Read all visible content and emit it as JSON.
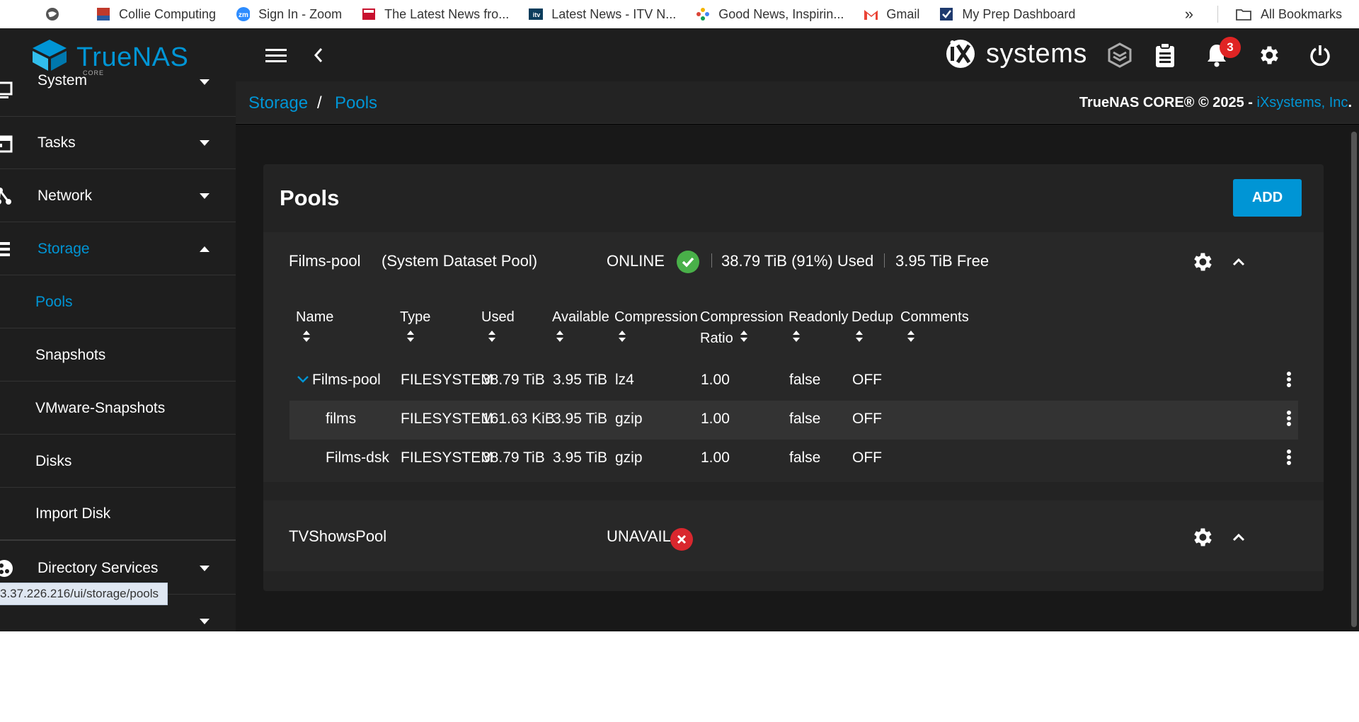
{
  "bookmarks": {
    "items": [
      {
        "label": "Collie Computing",
        "icon": "collie-favicon"
      },
      {
        "label": "Sign In - Zoom",
        "icon": "zoom-favicon"
      },
      {
        "label": "The Latest News fro...",
        "icon": "sky-news-favicon"
      },
      {
        "label": "Latest News - ITV N...",
        "icon": "itv-favicon"
      },
      {
        "label": "Good News, Inspirin...",
        "icon": "dots-favicon"
      },
      {
        "label": "Gmail",
        "icon": "gmail-favicon"
      },
      {
        "label": "My Prep Dashboard",
        "icon": "checkmark-favicon"
      }
    ],
    "more": "»",
    "all_bookmarks": "All Bookmarks"
  },
  "topbar": {
    "logo_text": "TrueNAS",
    "logo_sub": "CORE",
    "brand_text": "systems",
    "notification_count": "3"
  },
  "sidebar": {
    "items": [
      {
        "label": "System",
        "icon": "monitor-icon",
        "expanded": false
      },
      {
        "label": "Tasks",
        "icon": "calendar-icon",
        "expanded": false
      },
      {
        "label": "Network",
        "icon": "network-icon",
        "expanded": false
      },
      {
        "label": "Storage",
        "icon": "storage-icon",
        "expanded": true
      }
    ],
    "storage_sub": [
      {
        "label": "Pools",
        "active": true
      },
      {
        "label": "Snapshots",
        "active": false
      },
      {
        "label": "VMware-Snapshots",
        "active": false
      },
      {
        "label": "Disks",
        "active": false
      },
      {
        "label": "Import Disk",
        "active": false
      }
    ],
    "directory_services": "Directory Services",
    "url_tooltip": "3.37.226.216/ui/storage/pools"
  },
  "breadcrumb": {
    "parent": "Storage",
    "separator": "/",
    "current": "Pools"
  },
  "copyright": {
    "text": "TrueNAS CORE® © 2025 - ",
    "link": "iXsystems, Inc",
    "end": "."
  },
  "page": {
    "title": "Pools",
    "add_label": "ADD"
  },
  "pools": [
    {
      "name": "Films-pool",
      "note": "(System Dataset Pool)",
      "status": "ONLINE",
      "used": "38.79 TiB (91%) Used",
      "free": "3.95 TiB Free"
    },
    {
      "name": "TVShowsPool",
      "status": "UNAVAIL"
    }
  ],
  "table": {
    "columns": [
      "Name",
      "Type",
      "Used",
      "Available",
      "Compression",
      "Compression Ratio",
      "Readonly",
      "Dedup",
      "Comments"
    ],
    "col_ratio_line1": "Compression",
    "col_ratio_line2": "Ratio",
    "rows": [
      {
        "name": "Films-pool",
        "type": "FILESYSTEM",
        "used": "38.79 TiB",
        "available": "3.95 TiB",
        "compression": "lz4",
        "ratio": "1.00",
        "readonly": "false",
        "dedup": "OFF"
      },
      {
        "name": "films",
        "type": "FILESYSTEM",
        "used": "161.63 KiB",
        "available": "3.95 TiB",
        "compression": "gzip",
        "ratio": "1.00",
        "readonly": "false",
        "dedup": "OFF"
      },
      {
        "name": "Films-dsk",
        "type": "FILESYSTEM",
        "used": "38.79 TiB",
        "available": "3.95 TiB",
        "compression": "gzip",
        "ratio": "1.00",
        "readonly": "false",
        "dedup": "OFF"
      }
    ]
  },
  "colors": {
    "accent": "#0095d5",
    "online": "#49b049",
    "unavail": "#d9272e",
    "badge": "#e02424"
  }
}
